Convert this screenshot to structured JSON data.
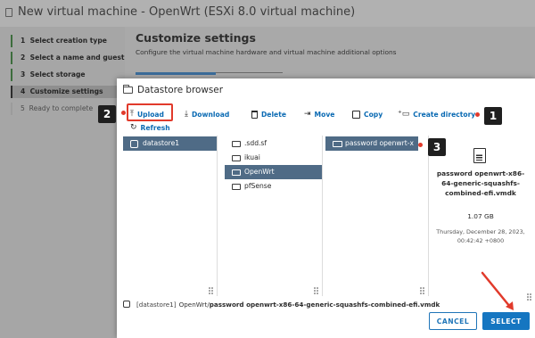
{
  "background": {
    "window_title": "New virtual machine - OpenWrt (ESXi 8.0 virtual machine)",
    "steps": [
      {
        "num": "1",
        "label": "Select creation type"
      },
      {
        "num": "2",
        "label": "Select a name and guest OS"
      },
      {
        "num": "3",
        "label": "Select storage"
      },
      {
        "num": "4",
        "label": "Customize settings"
      },
      {
        "num": "5",
        "label": "Ready to complete"
      }
    ],
    "main_heading": "Customize settings",
    "main_subtitle": "Configure the virtual machine hardware and virtual machine additional options"
  },
  "dialog": {
    "title": "Datastore browser",
    "toolbar": {
      "upload": "Upload",
      "download": "Download",
      "delete": "Delete",
      "move": "Move",
      "copy": "Copy",
      "create_directory": "Create directory",
      "refresh": "Refresh"
    },
    "col1": [
      {
        "label": "datastore1",
        "selected": true
      }
    ],
    "col2": [
      {
        "label": ".sdd.sf",
        "selected": false
      },
      {
        "label": "ikuai",
        "selected": false
      },
      {
        "label": "OpenWrt",
        "selected": true
      },
      {
        "label": "pfSense",
        "selected": false
      }
    ],
    "col3": [
      {
        "label": "password openwrt-x",
        "selected": true
      }
    ],
    "details": {
      "file_name": "password openwrt-x86-64-generic-squashfs-combined-efi.vmdk",
      "size": "1.07 GB",
      "modified": "Thursday, December 28, 2023, 00:42:42 +0800"
    },
    "path": {
      "datastore": "[datastore1]",
      "path_prefix": "OpenWrt/",
      "file": "password openwrt-x86-64-generic-squashfs-combined-efi.vmdk"
    },
    "buttons": {
      "cancel": "CANCEL",
      "select": "SELECT"
    }
  },
  "annotations": {
    "badge1": "1",
    "badge2": "2",
    "badge3": "3",
    "accent_color": "#e13a2b"
  }
}
